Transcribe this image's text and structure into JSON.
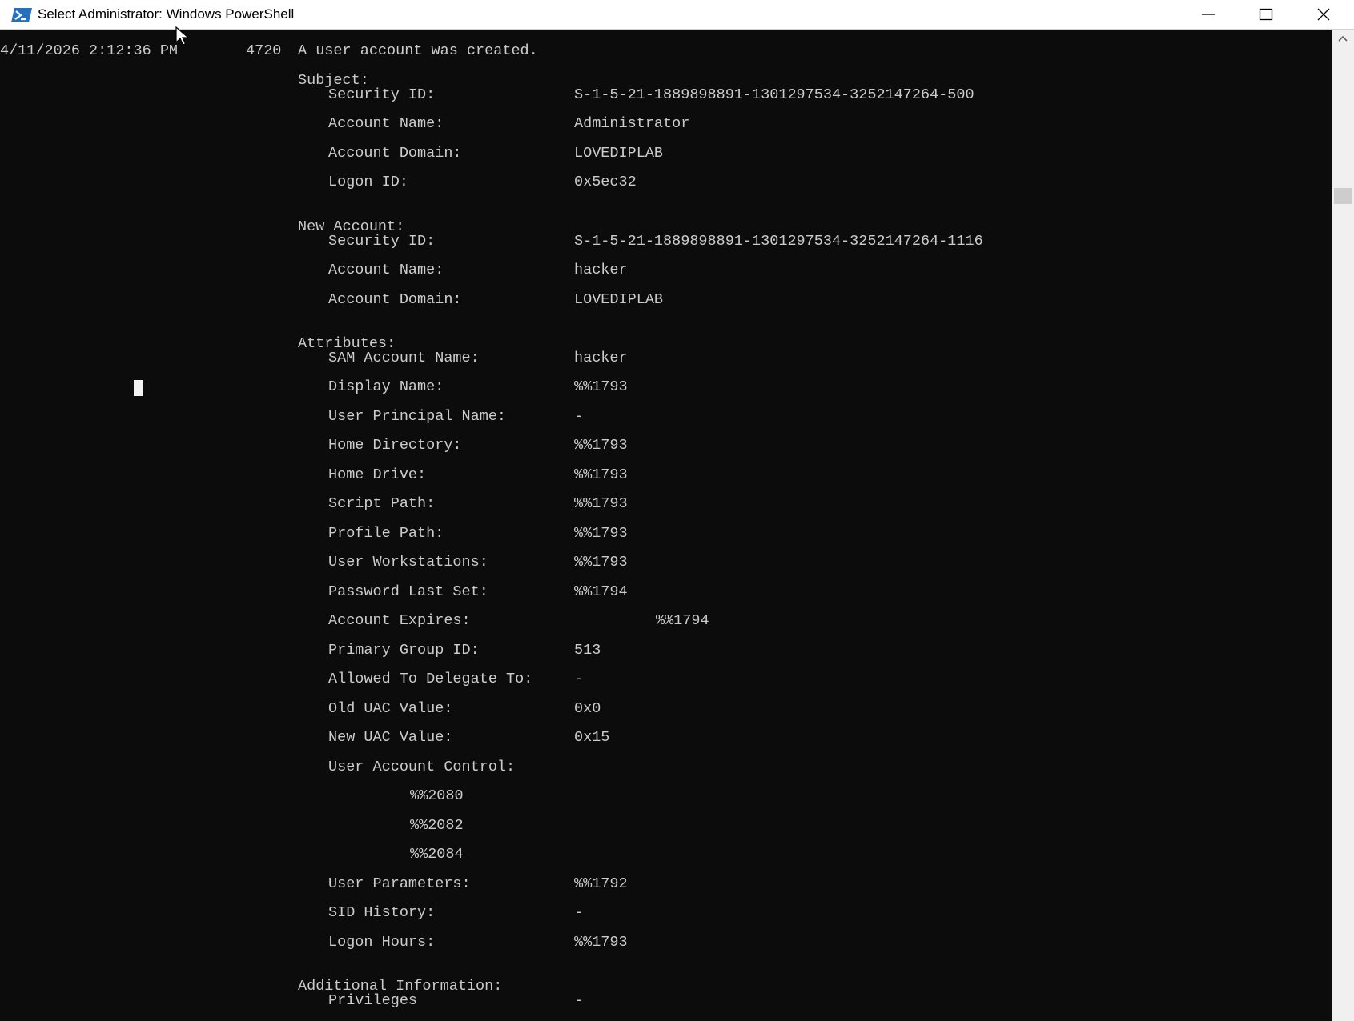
{
  "window": {
    "title": "Select Administrator: Windows PowerShell",
    "icon": "powershell-icon",
    "controls": {
      "minimize": "minimize-icon",
      "maximize": "maximize-icon",
      "close": "close-icon"
    }
  },
  "console": {
    "event_header": {
      "timestamp": "4/11/2026 2:12:36 PM",
      "event_id": "4720",
      "message": "A user account was created."
    },
    "subject": {
      "heading": "Subject:",
      "security_id_label": "Security ID:",
      "security_id": "S-1-5-21-1889898891-1301297534-3252147264-500",
      "account_name_label": "Account Name:",
      "account_name": "Administrator",
      "account_domain_label": "Account Domain:",
      "account_domain": "LOVEDIPLAB",
      "logon_id_label": "Logon ID:",
      "logon_id": "0x5ec32"
    },
    "new_account": {
      "heading": "New Account:",
      "security_id_label": "Security ID:",
      "security_id": "S-1-5-21-1889898891-1301297534-3252147264-1116",
      "account_name_label": "Account Name:",
      "account_name": "hacker",
      "account_domain_label": "Account Domain:",
      "account_domain": "LOVEDIPLAB"
    },
    "attributes": {
      "heading": "Attributes:",
      "sam_label": "SAM Account Name:",
      "sam": "hacker",
      "display_name_label": "Display Name:",
      "display_name": "%%1793",
      "upn_label": "User Principal Name:",
      "upn": "-",
      "home_dir_label": "Home Directory:",
      "home_dir": "%%1793",
      "home_drive_label": "Home Drive:",
      "home_drive": "%%1793",
      "script_path_label": "Script Path:",
      "script_path": "%%1793",
      "profile_path_label": "Profile Path:",
      "profile_path": "%%1793",
      "workstations_label": "User Workstations:",
      "workstations": "%%1793",
      "pwd_last_set_label": "Password Last Set:",
      "pwd_last_set": "%%1794",
      "expires_label": "Account Expires:",
      "expires": "%%1794",
      "primary_group_label": "Primary Group ID:",
      "primary_group": "513",
      "delegate_label": "Allowed To Delegate To:",
      "delegate": "-",
      "old_uac_label": "Old UAC Value:",
      "old_uac": "0x0",
      "new_uac_label": "New UAC Value:",
      "new_uac": "0x15",
      "uac_label": "User Account Control:",
      "uac_flags": [
        "%%2080",
        "%%2082",
        "%%2084"
      ],
      "user_params_label": "User Parameters:",
      "user_params": "%%1792",
      "sid_history_label": "SID History:",
      "sid_history": "-",
      "logon_hours_label": "Logon Hours:",
      "logon_hours": "%%1793"
    },
    "additional": {
      "heading": "Additional Information:",
      "privileges_label": "Privileges",
      "privileges": "-"
    }
  },
  "scrollbar": {
    "up_arrow": "chevron-up-icon"
  }
}
